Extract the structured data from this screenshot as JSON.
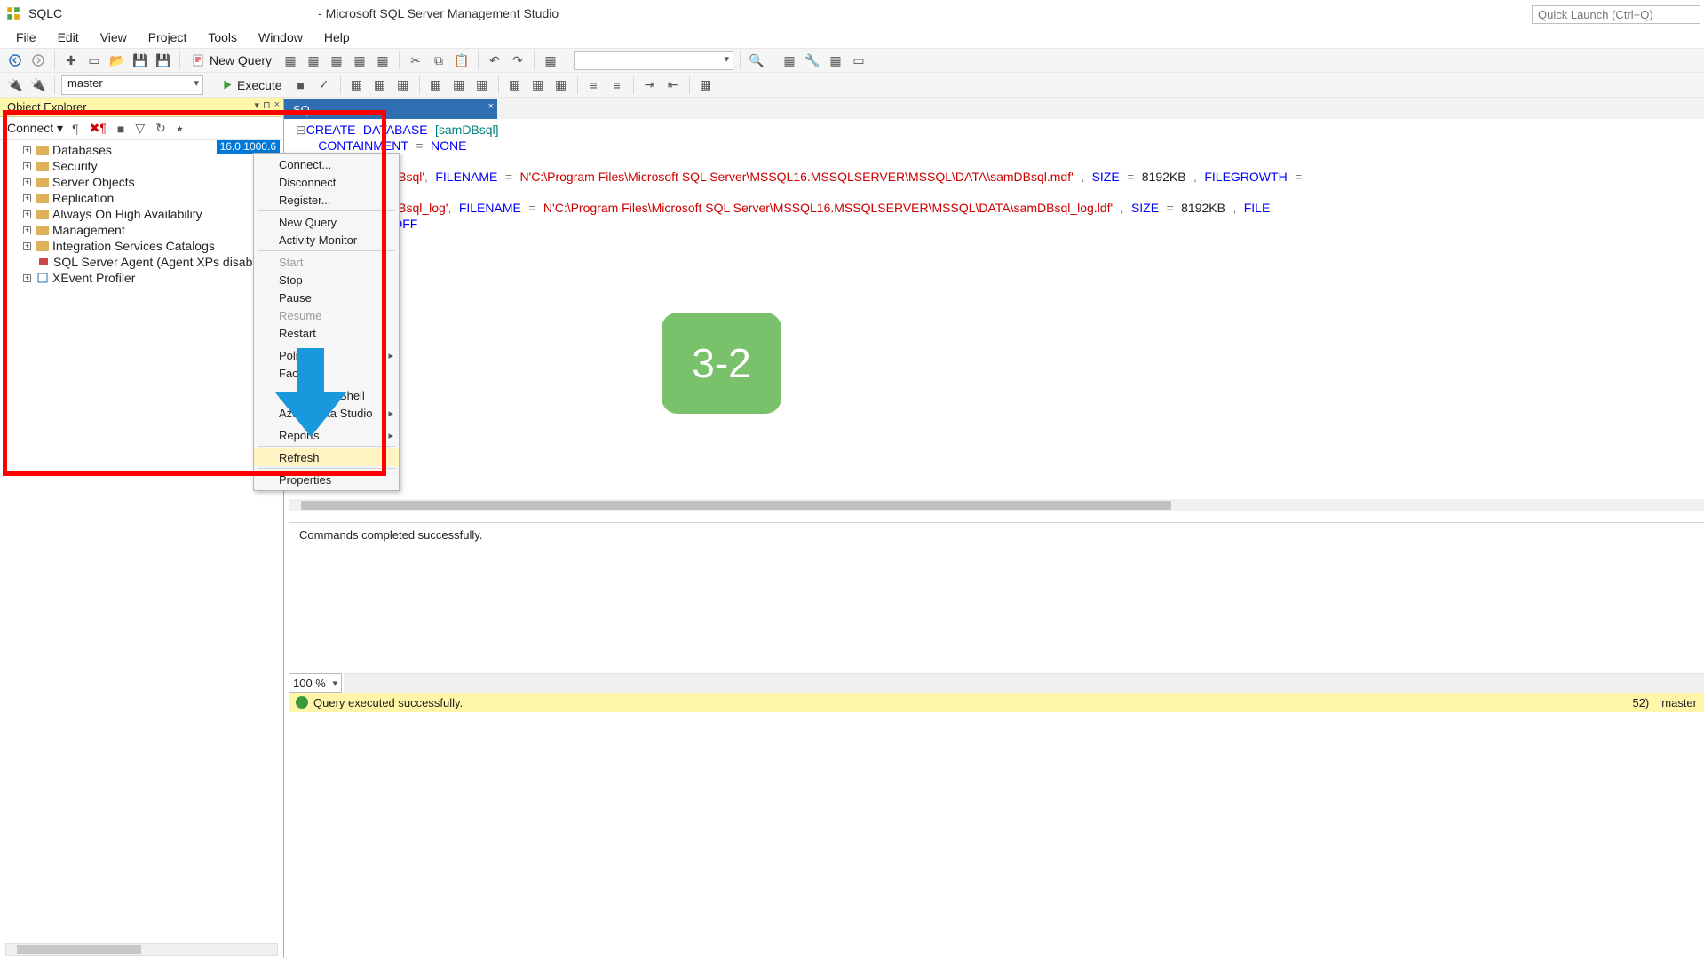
{
  "window": {
    "doc_short": "SQLC",
    "title_suffix": "- Microsoft SQL Server Management Studio",
    "quick_launch_placeholder": "Quick Launch (Ctrl+Q)"
  },
  "menu": {
    "file": "File",
    "edit": "Edit",
    "view": "View",
    "project": "Project",
    "tools": "Tools",
    "window": "Window",
    "help": "Help"
  },
  "toolbar": {
    "new_query": "New Query",
    "execute": "Execute",
    "db_selected": "master"
  },
  "object_explorer": {
    "title": "Object Explorer",
    "connect_label": "Connect ▾",
    "server_version": "16.0.1000.6",
    "nodes": {
      "databases": "Databases",
      "security": "Security",
      "server_objects": "Server Objects",
      "replication": "Replication",
      "always_on": "Always On High Availability",
      "management": "Management",
      "isc": "Integration Services Catalogs",
      "agent": "SQL Server Agent (Agent XPs disabled)",
      "xevent": "XEvent Profiler"
    }
  },
  "context_menu": {
    "connect": "Connect...",
    "disconnect": "Disconnect",
    "register": "Register...",
    "new_query": "New Query",
    "activity_monitor": "Activity Monitor",
    "start": "Start",
    "stop": "Stop",
    "pause": "Pause",
    "resume": "Resume",
    "restart": "Restart",
    "policies": "Policies",
    "facets": "Facets",
    "powershell": "Start PowerShell",
    "azure_ds": "Azure Data Studio",
    "reports": "Reports",
    "refresh": "Refresh",
    "properties": "Properties"
  },
  "editor": {
    "tab2_close": "×",
    "tab2_label": "SQ",
    "code_db_name": "samDBsql",
    "code_file1_name": "samDBsql",
    "code_file1_path": "C:\\Program Files\\Microsoft SQL Server\\MSSQL16.MSSQLSERVER\\MSSQL\\DATA\\samDBsql.mdf",
    "code_file2_name": "samDBsql_log",
    "code_file2_path": "C:\\Program Files\\Microsoft SQL Server\\MSSQL16.MSSQLSERVER\\MSSQL\\DATA\\samDBsql_log.ldf",
    "code_size": "8192KB",
    "messages_text": "Commands completed successfully.",
    "zoom": "100 %"
  },
  "status": {
    "msg": "Query executed successfully.",
    "srv_tail": "52)",
    "db": "master"
  },
  "annotation": {
    "bubble": "3-2"
  },
  "colors": {
    "accent": "#0078d7",
    "highlight_yellow": "#fff6a9",
    "red": "#ff0000",
    "arrow": "#1998dd",
    "green": "#79c16b"
  }
}
